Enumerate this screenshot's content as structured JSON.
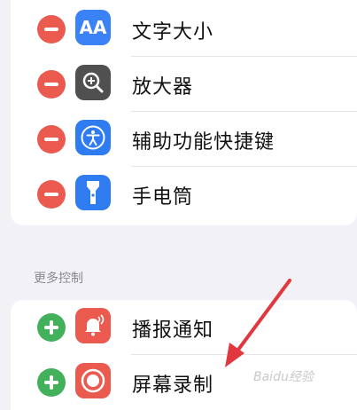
{
  "included_controls": [
    {
      "label": "文字大小",
      "icon": "text-size-icon",
      "color": "#3b82f6"
    },
    {
      "label": "放大器",
      "icon": "magnifier-icon",
      "color": "#505050"
    },
    {
      "label": "辅助功能快捷键",
      "icon": "accessibility-icon",
      "color": "#2f7cf0"
    },
    {
      "label": "手电筒",
      "icon": "flashlight-icon",
      "color": "#2f7cf0"
    }
  ],
  "more_controls_header": "更多控制",
  "more_controls": [
    {
      "label": "播报通知",
      "icon": "announce-notifications-icon",
      "color": "#ea5a4f"
    },
    {
      "label": "屏幕录制",
      "icon": "screen-recording-icon",
      "color": "#ea5a4f"
    }
  ],
  "text_size_glyph": "AA",
  "watermark": "Baidu经验"
}
